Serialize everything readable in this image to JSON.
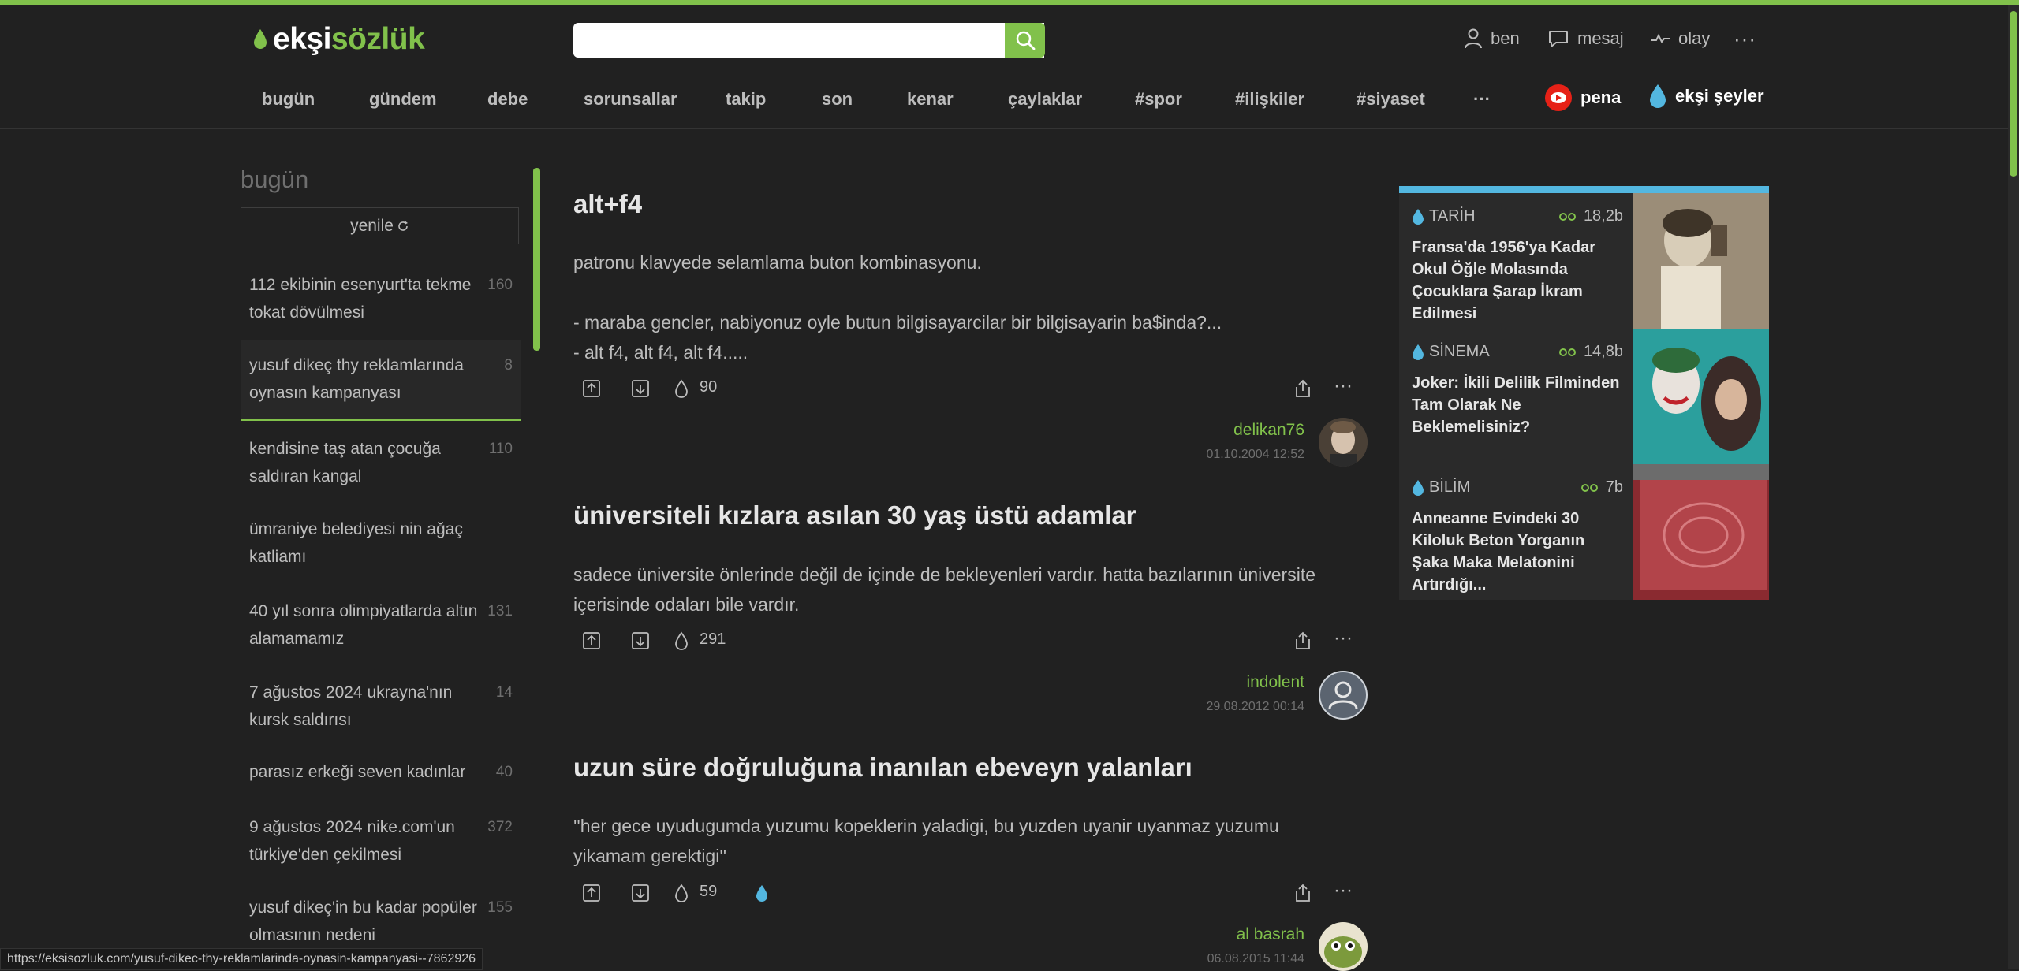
{
  "header": {
    "logo_part1": "ekşi",
    "logo_part2": "sözlük",
    "search_placeholder": "",
    "user_links": [
      {
        "label": "ben",
        "icon": "user-icon"
      },
      {
        "label": "mesaj",
        "icon": "message-icon"
      },
      {
        "label": "olay",
        "icon": "activity-icon"
      }
    ],
    "more": "···"
  },
  "topnav": {
    "tabs": [
      "bugün",
      "gündem",
      "debe",
      "sorunsallar",
      "takip",
      "son",
      "kenar",
      "çaylaklar",
      "#spor",
      "#ilişkiler",
      "#siyaset",
      "···"
    ],
    "pena": "pena",
    "seyler": "ekşi şeyler"
  },
  "sidebar": {
    "title": "bugün",
    "refresh": "yenile",
    "items": [
      {
        "title": "112 ekibinin esenyurt'ta tekme tokat dövülmesi",
        "count": "160"
      },
      {
        "title": "yusuf dikeç thy reklamlarında oynasın kampanyası",
        "count": "8"
      },
      {
        "title": "kendisine taş atan çocuğa saldıran kangal",
        "count": "110"
      },
      {
        "title": "ümraniye belediyesi nin ağaç katliamı",
        "count": ""
      },
      {
        "title": "40 yıl sonra olimpiyatlarda altın alamamamız",
        "count": "131"
      },
      {
        "title": "7 ağustos 2024 ukrayna'nın kursk saldırısı",
        "count": "14"
      },
      {
        "title": "parasız erkeği seven kadınlar",
        "count": "40"
      },
      {
        "title": "9 ağustos 2024 nike.com'un türkiye'den çekilmesi",
        "count": "372"
      },
      {
        "title": "yusuf dikeç'in bu kadar popüler olmasının nedeni",
        "count": "155"
      }
    ]
  },
  "entries": [
    {
      "title": "alt+f4",
      "body": [
        "patronu klavyede selamlama buton kombinasyonu.",
        "",
        "- maraba gencler, nabiyonuz oyle butun bilgisayarcilar bir bilgisayarin ba$inda?...",
        "- alt f4, alt f4, alt f4....."
      ],
      "favs": "90",
      "author": "delikan76",
      "date": "01.10.2004 12:52"
    },
    {
      "title": "üniversiteli kızlara asılan 30 yaş üstü adamlar",
      "body": [
        "sadece üniversite önlerinde değil de içinde de bekleyenleri vardır. hatta bazılarının üniversite içerisinde odaları bile vardır."
      ],
      "favs": "291",
      "author": "indolent",
      "date": "29.08.2012 00:14"
    },
    {
      "title": "uzun süre doğruluğuna inanılan ebeveyn yalanları",
      "body": [
        "''her gece uyudugumda yuzumu kopeklerin yaladigi, bu yuzden uyanir uyanmaz yuzumu yikamam gerektigi''"
      ],
      "favs": "59",
      "author": "al basrah",
      "date": "06.08.2015 11:44"
    }
  ],
  "cards": [
    {
      "category": "TARİH",
      "views": "18,2b",
      "title": "Fransa'da 1956'ya Kadar Okul Öğle Molasında Çocuklara Şarap İkram Edilmesi"
    },
    {
      "category": "SİNEMA",
      "views": "14,8b",
      "title": "Joker: İkili Delilik Filminden Tam Olarak Ne Beklemelisiniz?"
    },
    {
      "category": "BİLİM",
      "views": "7b",
      "title": "Anneanne Evindeki 30 Kiloluk Beton Yorganın Şaka Maka Melatonini Artırdığı..."
    }
  ],
  "statusbar": "https://eksisozluk.com/yusuf-dikec-thy-reklamlarinda-oynasin-kampanyasi--7862926",
  "colors": {
    "accent": "#81c14b",
    "background": "#212121",
    "card_accent": "#53b7e0",
    "pena_red": "#e62117"
  }
}
